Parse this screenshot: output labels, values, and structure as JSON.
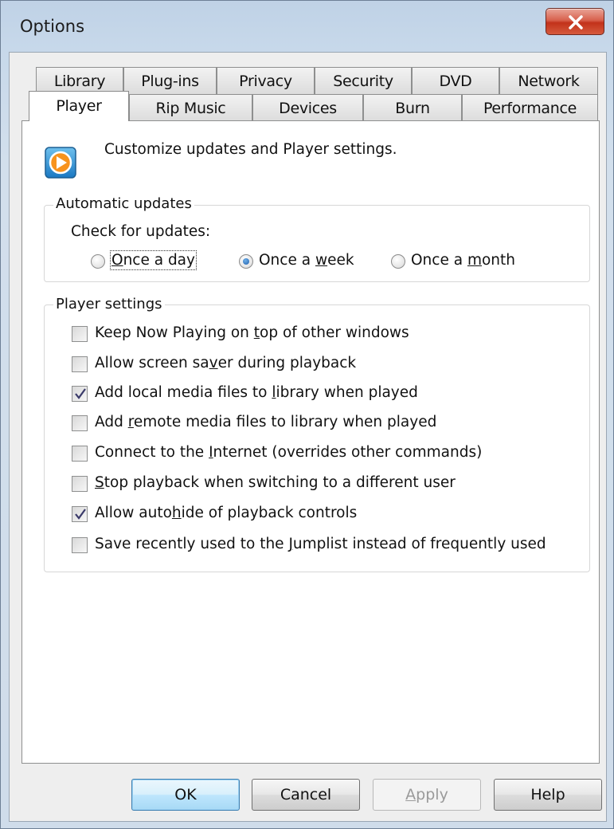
{
  "window": {
    "title": "Options"
  },
  "tabs": {
    "row1": [
      "Library",
      "Plug-ins",
      "Privacy",
      "Security",
      "DVD",
      "Network"
    ],
    "row2": [
      "Player",
      "Rip Music",
      "Devices",
      "Burn",
      "Performance"
    ],
    "active": "Player"
  },
  "intro": {
    "text": "Customize updates and Player settings.",
    "icon": "media-player-icon"
  },
  "updates": {
    "group_label": "Automatic updates",
    "check_label": "Check for updates:",
    "options": [
      {
        "pre": "",
        "key": "O",
        "post": "nce a day",
        "selected": false
      },
      {
        "pre": "Once a ",
        "key": "w",
        "post": "eek",
        "selected": true
      },
      {
        "pre": "Once a ",
        "key": "m",
        "post": "onth",
        "selected": false
      }
    ]
  },
  "settings": {
    "group_label": "Player settings",
    "items": [
      {
        "pre": "Keep Now Playing on ",
        "key": "t",
        "post": "op of other windows",
        "checked": false
      },
      {
        "pre": "Allow screen sa",
        "key": "v",
        "post": "er during playback",
        "checked": false
      },
      {
        "pre": "Add local media files to ",
        "key": "l",
        "post": "ibrary when played",
        "checked": true
      },
      {
        "pre": "Add ",
        "key": "r",
        "post": "emote media files to library when played",
        "checked": false
      },
      {
        "pre": "Connect to the ",
        "key": "I",
        "post": "nternet (overrides other commands)",
        "checked": false
      },
      {
        "pre": "",
        "key": "S",
        "post": "top playback when switching to a different user",
        "checked": false
      },
      {
        "pre": "Allow auto",
        "key": "h",
        "post": "ide of playback controls",
        "checked": true
      },
      {
        "pre": "Save recently used to the ",
        "key": "J",
        "post": "umplist instead of frequently used",
        "checked": false
      }
    ]
  },
  "buttons": {
    "ok": "OK",
    "cancel": "Cancel",
    "apply": {
      "key": "A",
      "rest": "pply"
    },
    "help": "Help"
  },
  "colors": {
    "close_button": "#c9432b",
    "panel": "#ffffff",
    "client": "#eeeeee",
    "default_button": "#bee6fd",
    "radio_dot": "#1f5fae"
  }
}
